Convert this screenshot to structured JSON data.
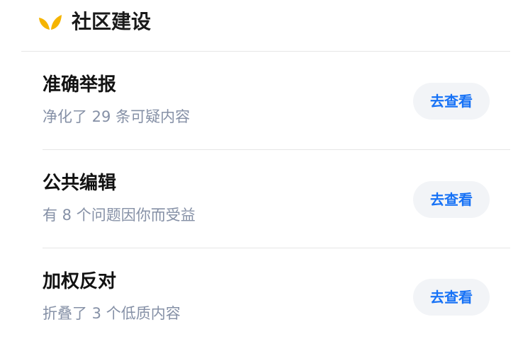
{
  "header": {
    "icon": "sprout-icon",
    "title": "社区建设",
    "accent_color": "#f5b400"
  },
  "items": [
    {
      "title": "准确举报",
      "subtitle": "净化了 29 条可疑内容",
      "button_label": "去查看"
    },
    {
      "title": "公共编辑",
      "subtitle": "有 8 个问题因你而受益",
      "button_label": "去查看"
    },
    {
      "title": "加权反对",
      "subtitle": "折叠了 3 个低质内容",
      "button_label": "去查看"
    }
  ],
  "colors": {
    "title": "#121212",
    "subtitle": "#8590a6",
    "button_text": "#1772f6",
    "button_bg": "#f2f4f7",
    "divider": "#e6e6e6"
  }
}
